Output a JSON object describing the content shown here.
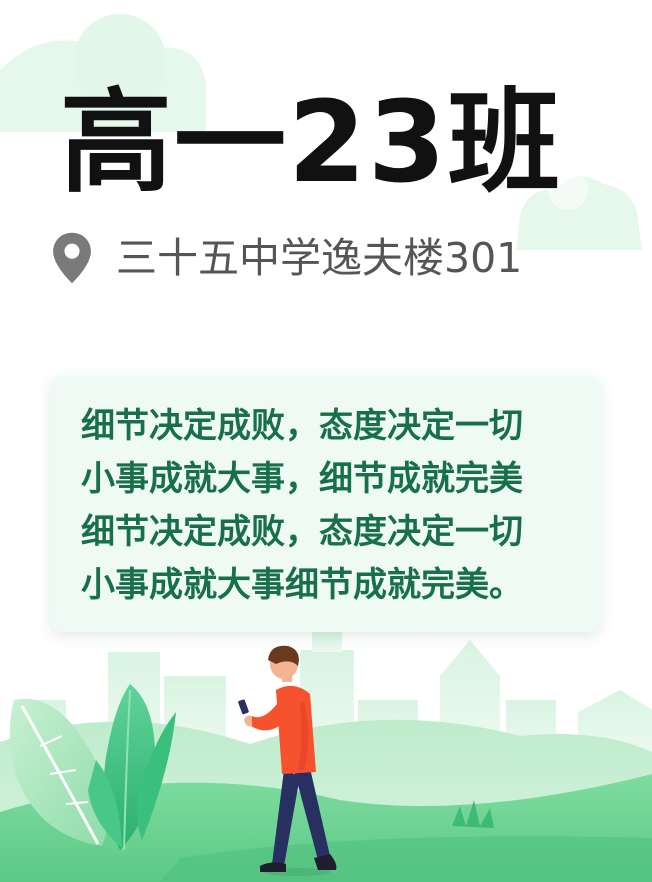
{
  "card": {
    "title": "高一23班",
    "location": "三十五中学逸夫楼301",
    "motto_lines": [
      "细节决定成败，态度决定一切",
      "小事成就大事，细节成就完美",
      "细节决定成败，态度决定一切",
      "小事成就大事细节成就完美。"
    ]
  },
  "icons": {
    "location": "map-pin-icon"
  },
  "colors": {
    "title": "#111111",
    "location_text": "#555555",
    "pin": "#7a7a7a",
    "motto_text": "#17704a",
    "motto_box": "#eefaf3",
    "grass_dark": "#6fd493",
    "grass_light": "#c4efd1",
    "cloud": "#e9f8ee",
    "person_shirt": "#f5522d",
    "person_pants": "#283062"
  }
}
